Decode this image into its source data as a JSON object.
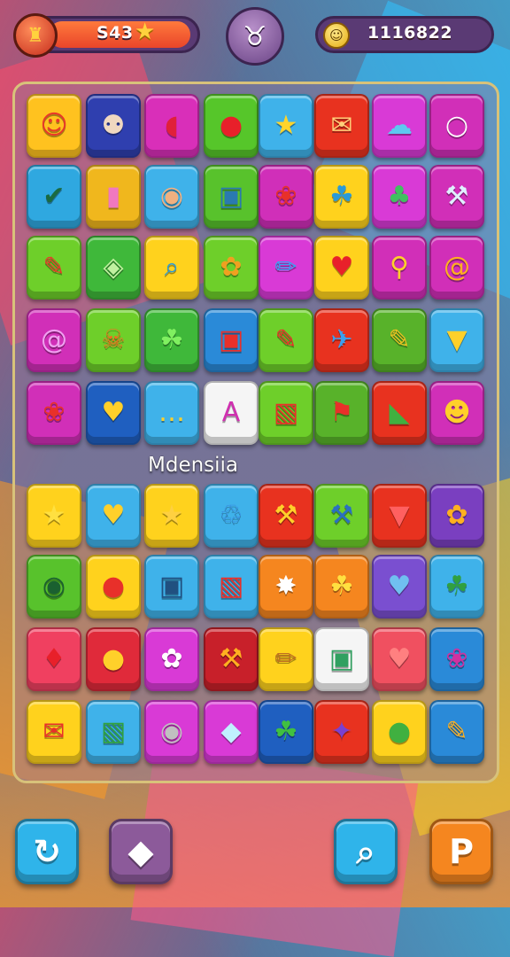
{
  "colors": {
    "background": "#7b3fa8",
    "board_border": "#d8c27a",
    "pill_fill": "#e9452a",
    "star": "#ffd23d"
  },
  "hud": {
    "score": "S43",
    "coins": "1116822",
    "left_badge_icon": "mask-icon",
    "star_icon": "star-icon",
    "coin_icon": "coin-icon",
    "center_button_icon": "scarf-icon",
    "center_button_glyph": "♉"
  },
  "board_label": "Mdensiia",
  "grid": [
    [
      {
        "icon": "face-icon",
        "glyph": "☺",
        "bg": "#ffc21f",
        "fg": "#e8372a"
      },
      {
        "icon": "mask-face-icon",
        "glyph": "⚉",
        "bg": "#2f3faf",
        "fg": "#f0d8c0"
      },
      {
        "icon": "speech-bubble-icon",
        "glyph": "◖",
        "bg": "#d92fb9",
        "fg": "#e0203a"
      },
      {
        "icon": "apple-icon",
        "glyph": "●",
        "bg": "#56c62a",
        "fg": "#e8202a"
      },
      {
        "icon": "star-icon",
        "glyph": "★",
        "bg": "#3fb2ea",
        "fg": "#ffd42a"
      },
      {
        "icon": "envelope-icon",
        "glyph": "✉",
        "bg": "#e8321f",
        "fg": "#ffcf7a"
      },
      {
        "icon": "cloud-icon",
        "glyph": "☁",
        "bg": "#d93ad6",
        "fg": "#5ec8f0"
      },
      {
        "icon": "ring-icon",
        "glyph": "○",
        "bg": "#d12fb8",
        "fg": "#ffffff"
      }
    ],
    [
      {
        "icon": "check-circle-icon",
        "glyph": "✔",
        "bg": "#2fa8e0",
        "fg": "#1a6a40"
      },
      {
        "icon": "eraser-icon",
        "glyph": "▮",
        "bg": "#f0b71d",
        "fg": "#f078c0"
      },
      {
        "icon": "puzzle-icon",
        "glyph": "◉",
        "bg": "#3fb2ea",
        "fg": "#f0b080"
      },
      {
        "icon": "bag-icon",
        "glyph": "▣",
        "bg": "#58c22c",
        "fg": "#2a7ab0"
      },
      {
        "icon": "ladybug-icon",
        "glyph": "❀",
        "bg": "#d02fb9",
        "fg": "#e8302a"
      },
      {
        "icon": "leaf-icon",
        "glyph": "☘",
        "bg": "#ffd21d",
        "fg": "#2a9ad8"
      },
      {
        "icon": "balloon-icon",
        "glyph": "♣",
        "bg": "#d93ad6",
        "fg": "#40c060"
      },
      {
        "icon": "wand-icon",
        "glyph": "⚒",
        "bg": "#d12fb8",
        "fg": "#e0f0ff"
      }
    ],
    [
      {
        "icon": "brush-icon",
        "glyph": "✎",
        "bg": "#6ecf2a",
        "fg": "#e83a2a"
      },
      {
        "icon": "shield-icon",
        "glyph": "◈",
        "bg": "#3fb83a",
        "fg": "#c0f0a0"
      },
      {
        "icon": "magnifier-icon",
        "glyph": "⌕",
        "bg": "#ffd21d",
        "fg": "#2a9ad8"
      },
      {
        "icon": "flower-icon",
        "glyph": "✿",
        "bg": "#6ecf2a",
        "fg": "#f0a020"
      },
      {
        "icon": "pencil-icon",
        "glyph": "✏",
        "bg": "#d93ad6",
        "fg": "#3aa0f0"
      },
      {
        "icon": "heart-icon",
        "glyph": "♥",
        "bg": "#ffd21d",
        "fg": "#e8202a"
      },
      {
        "icon": "key-icon",
        "glyph": "⚲",
        "bg": "#d12fb8",
        "fg": "#ffd02a"
      },
      {
        "icon": "spiral-icon",
        "glyph": "@",
        "bg": "#d12fb8",
        "fg": "#ffb020"
      }
    ],
    [
      {
        "icon": "at-sign-icon",
        "glyph": "@",
        "bg": "#d12fb8",
        "fg": "#f0a0f0"
      },
      {
        "icon": "torch-icon",
        "glyph": "☠",
        "bg": "#6ecf2a",
        "fg": "#f06a20"
      },
      {
        "icon": "blob-icon",
        "glyph": "☘",
        "bg": "#3fb83a",
        "fg": "#80f060"
      },
      {
        "icon": "shopping-bag-icon",
        "glyph": "▣",
        "bg": "#2a8ad8",
        "fg": "#e8302a"
      },
      {
        "icon": "crayon-icon",
        "glyph": "✎",
        "bg": "#6ecf2a",
        "fg": "#e8302a"
      },
      {
        "icon": "plane-icon",
        "glyph": "✈",
        "bg": "#e8321f",
        "fg": "#3aa0f0"
      },
      {
        "icon": "paintbrush-icon",
        "glyph": "✎",
        "bg": "#58b22a",
        "fg": "#f0c020"
      },
      {
        "icon": "ice-cream-icon",
        "glyph": "▼",
        "bg": "#3fb2ea",
        "fg": "#ffd02a"
      }
    ],
    [
      {
        "icon": "strawberry-icon",
        "glyph": "❀",
        "bg": "#d12fb8",
        "fg": "#e8302a"
      },
      {
        "icon": "heart-icon",
        "glyph": "♥",
        "bg": "#1f5fc0",
        "fg": "#ffd02a"
      },
      {
        "icon": "chat-bubble-icon",
        "glyph": "…",
        "bg": "#3fb2ea",
        "fg": "#ffd02a"
      },
      {
        "icon": "letter-a-icon",
        "glyph": "A",
        "bg": "#f5f5f5",
        "fg": "#d030b0"
      },
      {
        "icon": "cards-icon",
        "glyph": "▧",
        "bg": "#6ecf2a",
        "fg": "#e8302a"
      },
      {
        "icon": "flag-icon",
        "glyph": "⚑",
        "bg": "#58b22a",
        "fg": "#e8302a"
      },
      {
        "icon": "cube-icon",
        "glyph": "◣",
        "bg": "#e8321f",
        "fg": "#40b040"
      },
      {
        "icon": "smiley-icon",
        "glyph": "☻",
        "bg": "#d12fb8",
        "fg": "#ffd02a"
      }
    ],
    [
      {
        "icon": "star-icon",
        "glyph": "★",
        "bg": "#ffd21d",
        "fg": "#ffe040"
      },
      {
        "icon": "heart-icon",
        "glyph": "♥",
        "bg": "#3fb2ea",
        "fg": "#ffd02a"
      },
      {
        "icon": "star-icon",
        "glyph": "★",
        "bg": "#ffd21d",
        "fg": "#ffd040"
      },
      {
        "icon": "lollipop-icon",
        "glyph": "♲",
        "bg": "#3fb2ea",
        "fg": "#3a90e0"
      },
      {
        "icon": "pin-icon",
        "glyph": "⚒",
        "bg": "#e8321f",
        "fg": "#ffd02a"
      },
      {
        "icon": "wrench-icon",
        "glyph": "⚒",
        "bg": "#6ecf2a",
        "fg": "#2a70c0"
      },
      {
        "icon": "triangle-heart-icon",
        "glyph": "▼",
        "bg": "#e8321f",
        "fg": "#ff6060"
      },
      {
        "icon": "star-flower-icon",
        "glyph": "✿",
        "bg": "#7a3fc0",
        "fg": "#ffb020"
      }
    ],
    [
      {
        "icon": "eye-icon",
        "glyph": "◉",
        "bg": "#58c22c",
        "fg": "#1a6030"
      },
      {
        "icon": "tomato-icon",
        "glyph": "●",
        "bg": "#ffd21d",
        "fg": "#e8302a"
      },
      {
        "icon": "box-icon",
        "glyph": "▣",
        "bg": "#3fb2ea",
        "fg": "#205080"
      },
      {
        "icon": "book-icon",
        "glyph": "▧",
        "bg": "#3fb2ea",
        "fg": "#e8302a"
      },
      {
        "icon": "splash-icon",
        "glyph": "✸",
        "bg": "#f5861f",
        "fg": "#ffffff"
      },
      {
        "icon": "maple-leaf-icon",
        "glyph": "☘",
        "bg": "#f5861f",
        "fg": "#ffe040"
      },
      {
        "icon": "heart-icon",
        "glyph": "♥",
        "bg": "#7a4fd0",
        "fg": "#70c0f0"
      },
      {
        "icon": "leaf-icon",
        "glyph": "☘",
        "bg": "#3fb2ea",
        "fg": "#30a040"
      }
    ],
    [
      {
        "icon": "diamond-icon",
        "glyph": "♦",
        "bg": "#f04060",
        "fg": "#e8202a"
      },
      {
        "icon": "circle-icon",
        "glyph": "●",
        "bg": "#e02a3a",
        "fg": "#ffd02a"
      },
      {
        "icon": "flower-icon",
        "glyph": "✿",
        "bg": "#d93ad6",
        "fg": "#ffffff"
      },
      {
        "icon": "hammer-icon",
        "glyph": "⚒",
        "bg": "#c8202a",
        "fg": "#ffb020"
      },
      {
        "icon": "pencil-icon",
        "glyph": "✏",
        "bg": "#ffd21d",
        "fg": "#c07020"
      },
      {
        "icon": "box-outline-icon",
        "glyph": "▣",
        "bg": "#f5f5f5",
        "fg": "#30a060"
      },
      {
        "icon": "heart-icon",
        "glyph": "♥",
        "bg": "#f05060",
        "fg": "#ff8080"
      },
      {
        "icon": "bouquet-icon",
        "glyph": "❀",
        "bg": "#2a8ad8",
        "fg": "#d030a0"
      }
    ],
    [
      {
        "icon": "mail-icon",
        "glyph": "✉",
        "bg": "#ffd21d",
        "fg": "#e8302a"
      },
      {
        "icon": "picture-icon",
        "glyph": "▧",
        "bg": "#3fb2ea",
        "fg": "#30a040"
      },
      {
        "icon": "safe-icon",
        "glyph": "◉",
        "bg": "#d93ad6",
        "fg": "#c0c0c0"
      },
      {
        "icon": "ice-cube-icon",
        "glyph": "◆",
        "bg": "#d93ad6",
        "fg": "#c0f0ff"
      },
      {
        "icon": "chili-icon",
        "glyph": "☘",
        "bg": "#1f5fc0",
        "fg": "#40c040"
      },
      {
        "icon": "shuriken-icon",
        "glyph": "✦",
        "bg": "#e8321f",
        "fg": "#7a40d0"
      },
      {
        "icon": "balloon-icon",
        "glyph": "●",
        "bg": "#ffd21d",
        "fg": "#40b040"
      },
      {
        "icon": "cone-icon",
        "glyph": "✎",
        "bg": "#2a8ad8",
        "fg": "#ffb020"
      }
    ]
  ],
  "bottom_buttons": [
    {
      "icon": "refresh-icon",
      "glyph": "↻",
      "bg": "#2fb4ea"
    },
    {
      "icon": "gem-icon",
      "glyph": "◆",
      "bg": "#8c5a9a"
    },
    {
      "icon": "search-icon",
      "glyph": "⌕",
      "bg": "#2fb4ea"
    },
    {
      "icon": "pause-icon",
      "glyph": "P",
      "bg": "#f5861f"
    }
  ]
}
